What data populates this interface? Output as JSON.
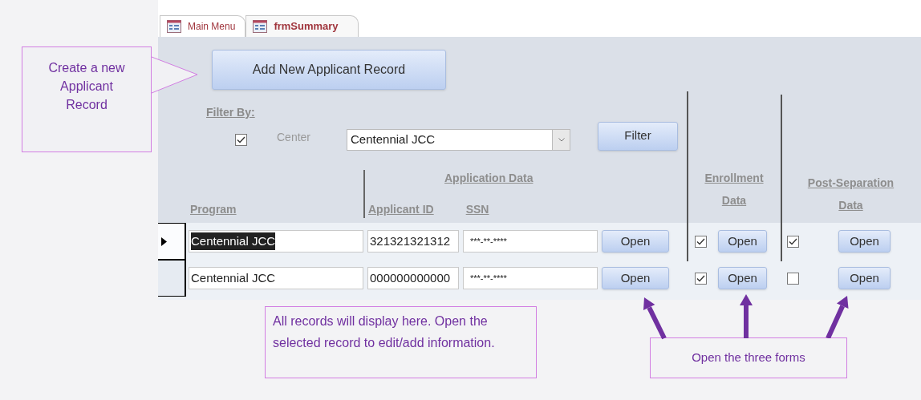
{
  "tabs": [
    {
      "label": "Main Menu",
      "selected": false
    },
    {
      "label": "frmSummary",
      "selected": true
    }
  ],
  "add_button": "Add New Applicant Record",
  "filter": {
    "title": "Filter By:",
    "checked": true,
    "label": "Center",
    "value": "Centennial JCC",
    "button": "Filter"
  },
  "headers": {
    "program": "Program",
    "application_group": "Application Data",
    "applicant_id": "Applicant ID",
    "ssn": "SSN",
    "enrollment": "Enrollment Data",
    "post_separation": "Post-Separation Data"
  },
  "rows": [
    {
      "selected": true,
      "program": "Centennial JCC",
      "applicant_id": "321321321312",
      "ssn": "***-**-****",
      "open": "Open",
      "enrollment_checked": true,
      "enrollment_open": "Open",
      "post_checked": true,
      "post_open": "Open"
    },
    {
      "selected": false,
      "program": "Centennial JCC",
      "applicant_id": "000000000000",
      "ssn": "***-**-****",
      "open": "Open",
      "enrollment_checked": true,
      "enrollment_open": "Open",
      "post_checked": false,
      "post_open": "Open"
    }
  ],
  "callouts": {
    "create": "Create a new Applicant Record",
    "records": "All records will display here. Open the selected record to edit/add information.",
    "forms": "Open the three forms"
  }
}
